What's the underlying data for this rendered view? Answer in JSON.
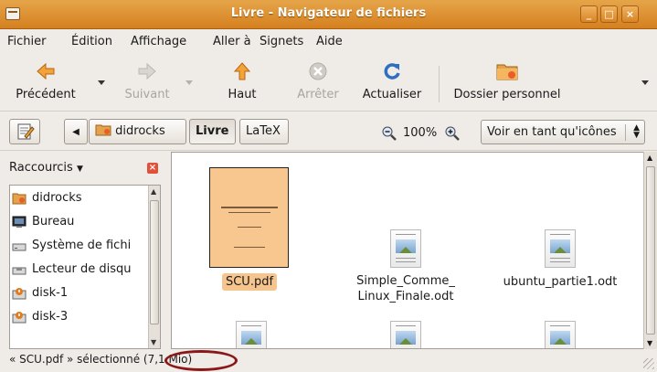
{
  "window": {
    "title": "Livre - Navigateur de fichiers"
  },
  "menu": [
    "Fichier",
    "Édition",
    "Affichage",
    "Aller à",
    "Signets",
    "Aide"
  ],
  "toolbar": {
    "back": "Précédent",
    "forward": "Suivant",
    "up": "Haut",
    "stop": "Arrêter",
    "reload": "Actualiser",
    "home": "Dossier personnel"
  },
  "location": {
    "path": [
      "didrocks",
      "Livre",
      "LaTeX"
    ],
    "zoom": "100%",
    "view_mode": "Voir en tant qu'icônes"
  },
  "sidebar": {
    "title": "Raccourcis",
    "items": [
      {
        "label": "didrocks",
        "icon": "home-folder-icon"
      },
      {
        "label": "Bureau",
        "icon": "desktop-icon"
      },
      {
        "label": "Système de fichi",
        "icon": "drive-icon"
      },
      {
        "label": "Lecteur de disqu",
        "icon": "floppy-icon"
      },
      {
        "label": "disk-1",
        "icon": "usb-disk-icon"
      },
      {
        "label": "disk-3",
        "icon": "usb-disk-icon"
      }
    ]
  },
  "files": [
    {
      "name": "SCU.pdf",
      "selected": true
    },
    {
      "name": "Simple_Comme_\nLinux_Finale.odt",
      "selected": false
    },
    {
      "name": "ubuntu_partie1.odt",
      "selected": false
    }
  ],
  "status": {
    "text": "« SCU.pdf » sélectionné (7,1 Mio)"
  },
  "colors": {
    "titlebar": "#d5801f",
    "selection": "#f6c58d",
    "highlight_ring": "#8b1818"
  }
}
